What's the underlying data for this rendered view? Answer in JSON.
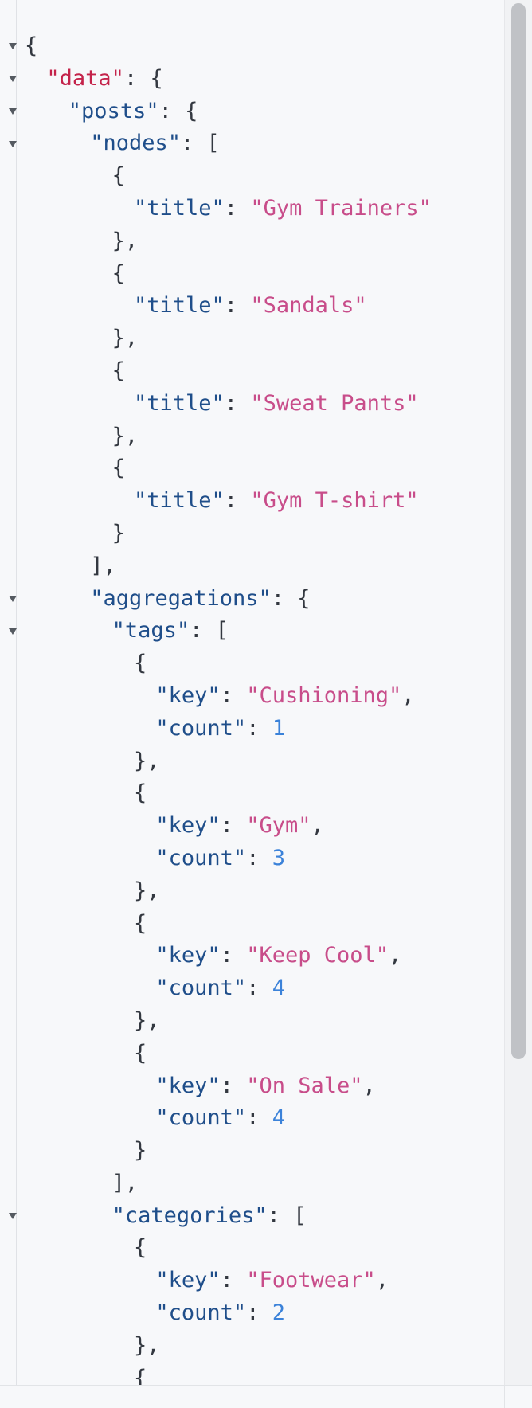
{
  "json_viewer": {
    "lines": [
      {
        "key": "",
        "sep": "",
        "value": "",
        "type": "",
        "open": "{",
        "fold": true,
        "indent": 0
      },
      {
        "key": "\"data\"",
        "sep": ": ",
        "value": "",
        "type": "",
        "open": "{",
        "fold": true,
        "indent": 1,
        "root": true
      },
      {
        "key": "\"posts\"",
        "sep": ": ",
        "value": "",
        "type": "",
        "open": "{",
        "fold": true,
        "indent": 2
      },
      {
        "key": "\"nodes\"",
        "sep": ": ",
        "value": "",
        "type": "",
        "open": "[",
        "fold": true,
        "indent": 3
      },
      {
        "key": "",
        "sep": "",
        "value": "",
        "type": "",
        "open": "{",
        "fold": false,
        "indent": 4
      },
      {
        "key": "\"title\"",
        "sep": ": ",
        "value": "\"Gym Trainers\"",
        "type": "string",
        "open": "",
        "fold": false,
        "indent": 5
      },
      {
        "key": "",
        "sep": "",
        "value": "",
        "type": "",
        "open": "},",
        "fold": false,
        "indent": 4
      },
      {
        "key": "",
        "sep": "",
        "value": "",
        "type": "",
        "open": "{",
        "fold": false,
        "indent": 4
      },
      {
        "key": "\"title\"",
        "sep": ": ",
        "value": "\"Sandals\"",
        "type": "string",
        "open": "",
        "fold": false,
        "indent": 5
      },
      {
        "key": "",
        "sep": "",
        "value": "",
        "type": "",
        "open": "},",
        "fold": false,
        "indent": 4
      },
      {
        "key": "",
        "sep": "",
        "value": "",
        "type": "",
        "open": "{",
        "fold": false,
        "indent": 4
      },
      {
        "key": "\"title\"",
        "sep": ": ",
        "value": "\"Sweat Pants\"",
        "type": "string",
        "open": "",
        "fold": false,
        "indent": 5
      },
      {
        "key": "",
        "sep": "",
        "value": "",
        "type": "",
        "open": "},",
        "fold": false,
        "indent": 4
      },
      {
        "key": "",
        "sep": "",
        "value": "",
        "type": "",
        "open": "{",
        "fold": false,
        "indent": 4
      },
      {
        "key": "\"title\"",
        "sep": ": ",
        "value": "\"Gym T-shirt\"",
        "type": "string",
        "open": "",
        "fold": false,
        "indent": 5
      },
      {
        "key": "",
        "sep": "",
        "value": "",
        "type": "",
        "open": "}",
        "fold": false,
        "indent": 4
      },
      {
        "key": "",
        "sep": "",
        "value": "",
        "type": "",
        "open": "],",
        "fold": false,
        "indent": 3
      },
      {
        "key": "\"aggregations\"",
        "sep": ": ",
        "value": "",
        "type": "",
        "open": "{",
        "fold": true,
        "indent": 3
      },
      {
        "key": "\"tags\"",
        "sep": ": ",
        "value": "",
        "type": "",
        "open": "[",
        "fold": true,
        "indent": 4
      },
      {
        "key": "",
        "sep": "",
        "value": "",
        "type": "",
        "open": "{",
        "fold": false,
        "indent": 5
      },
      {
        "key": "\"key\"",
        "sep": ": ",
        "value": "\"Cushioning\"",
        "type": "string",
        "open": ",",
        "fold": false,
        "indent": 6
      },
      {
        "key": "\"count\"",
        "sep": ": ",
        "value": "1",
        "type": "number",
        "open": "",
        "fold": false,
        "indent": 6
      },
      {
        "key": "",
        "sep": "",
        "value": "",
        "type": "",
        "open": "},",
        "fold": false,
        "indent": 5
      },
      {
        "key": "",
        "sep": "",
        "value": "",
        "type": "",
        "open": "{",
        "fold": false,
        "indent": 5
      },
      {
        "key": "\"key\"",
        "sep": ": ",
        "value": "\"Gym\"",
        "type": "string",
        "open": ",",
        "fold": false,
        "indent": 6
      },
      {
        "key": "\"count\"",
        "sep": ": ",
        "value": "3",
        "type": "number",
        "open": "",
        "fold": false,
        "indent": 6
      },
      {
        "key": "",
        "sep": "",
        "value": "",
        "type": "",
        "open": "},",
        "fold": false,
        "indent": 5
      },
      {
        "key": "",
        "sep": "",
        "value": "",
        "type": "",
        "open": "{",
        "fold": false,
        "indent": 5
      },
      {
        "key": "\"key\"",
        "sep": ": ",
        "value": "\"Keep Cool\"",
        "type": "string",
        "open": ",",
        "fold": false,
        "indent": 6
      },
      {
        "key": "\"count\"",
        "sep": ": ",
        "value": "4",
        "type": "number",
        "open": "",
        "fold": false,
        "indent": 6
      },
      {
        "key": "",
        "sep": "",
        "value": "",
        "type": "",
        "open": "},",
        "fold": false,
        "indent": 5
      },
      {
        "key": "",
        "sep": "",
        "value": "",
        "type": "",
        "open": "{",
        "fold": false,
        "indent": 5
      },
      {
        "key": "\"key\"",
        "sep": ": ",
        "value": "\"On Sale\"",
        "type": "string",
        "open": ",",
        "fold": false,
        "indent": 6
      },
      {
        "key": "\"count\"",
        "sep": ": ",
        "value": "4",
        "type": "number",
        "open": "",
        "fold": false,
        "indent": 6
      },
      {
        "key": "",
        "sep": "",
        "value": "",
        "type": "",
        "open": "}",
        "fold": false,
        "indent": 5
      },
      {
        "key": "",
        "sep": "",
        "value": "",
        "type": "",
        "open": "],",
        "fold": false,
        "indent": 4
      },
      {
        "key": "\"categories\"",
        "sep": ": ",
        "value": "",
        "type": "",
        "open": "[",
        "fold": true,
        "indent": 4
      },
      {
        "key": "",
        "sep": "",
        "value": "",
        "type": "",
        "open": "{",
        "fold": false,
        "indent": 5
      },
      {
        "key": "\"key\"",
        "sep": ": ",
        "value": "\"Footwear\"",
        "type": "string",
        "open": ",",
        "fold": false,
        "indent": 6
      },
      {
        "key": "\"count\"",
        "sep": ": ",
        "value": "2",
        "type": "number",
        "open": "",
        "fold": false,
        "indent": 6
      },
      {
        "key": "",
        "sep": "",
        "value": "",
        "type": "",
        "open": "},",
        "fold": false,
        "indent": 5
      },
      {
        "key": "",
        "sep": "",
        "value": "",
        "type": "",
        "open": "{",
        "fold": false,
        "indent": 5
      }
    ]
  },
  "colors": {
    "property": "#1f4e8a",
    "root_property": "#c4234a",
    "string": "#c84d8a",
    "number": "#3b82d9",
    "punctuation": "#333840",
    "background": "#f7f8fa"
  }
}
